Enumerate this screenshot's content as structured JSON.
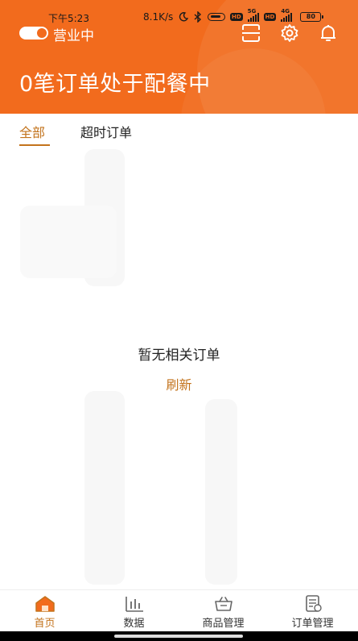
{
  "status_bar": {
    "time": "下午5:23",
    "network_speed": "8.1K/s",
    "hd_badge": "HD",
    "net1": "5G",
    "net2": "4G",
    "battery": "80"
  },
  "header": {
    "store_status_label": "营业中",
    "store_open": true,
    "headline": "0笔订单处于配餐中",
    "icons": [
      "scan-icon",
      "gear-icon",
      "bell-icon"
    ],
    "bg_color": "#f26b1d"
  },
  "tabs": [
    {
      "label": "全部",
      "active": true
    },
    {
      "label": "超时订单",
      "active": false
    }
  ],
  "content": {
    "empty_message": "暂无相关订单",
    "refresh_label": "刷新"
  },
  "bottom_nav": [
    {
      "label": "首页",
      "icon": "home-icon",
      "active": true
    },
    {
      "label": "数据",
      "icon": "bar-chart-icon",
      "active": false
    },
    {
      "label": "商品管理",
      "icon": "basket-icon",
      "active": false
    },
    {
      "label": "订单管理",
      "icon": "order-list-icon",
      "active": false
    }
  ],
  "colors": {
    "brand": "#f26b1d",
    "accent_text": "#c3731c"
  }
}
